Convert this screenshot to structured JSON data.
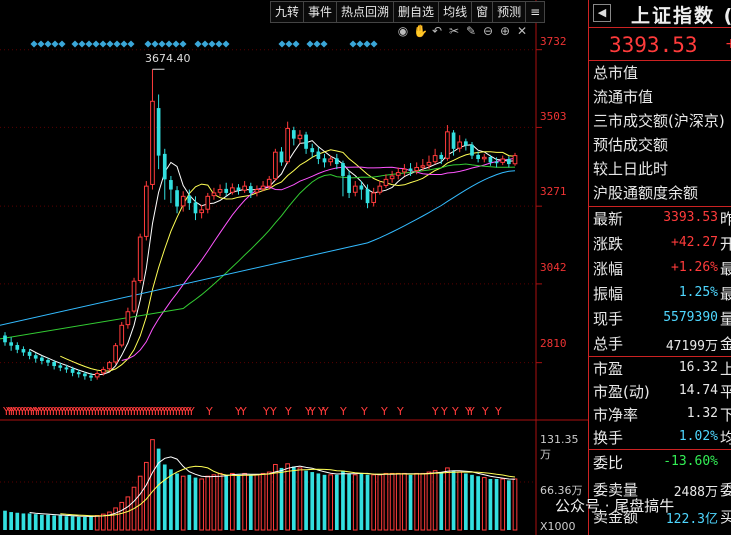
{
  "toolbar": {
    "buttons": [
      "九转",
      "事件",
      "热点回溯",
      "删自选",
      "均线",
      "窗",
      "预测",
      "≡"
    ]
  },
  "chart_icons": [
    "eye-icon",
    "hand-icon",
    "undo-icon",
    "scissors-icon",
    "pencil-icon",
    "zoom-out-icon",
    "zoom-in-icon",
    "close-icon"
  ],
  "chart_data": {
    "type": "candlestick",
    "price_axis_labels": [
      "3732",
      "3503",
      "3271",
      "3042",
      "2810"
    ],
    "price_range": [
      2700,
      3790
    ],
    "peak_label": "3674.40",
    "peak_value": 3674.4,
    "volume_axis_labels": [
      "131.35万",
      "66.36万",
      "X1000"
    ],
    "volume_range": [
      0,
      1450000
    ],
    "candles": [
      [
        2890,
        2870,
        2900,
        2860
      ],
      [
        2870,
        2860,
        2885,
        2845
      ],
      [
        2862,
        2848,
        2870,
        2838
      ],
      [
        2850,
        2840,
        2858,
        2830
      ],
      [
        2842,
        2830,
        2850,
        2820
      ],
      [
        2832,
        2822,
        2838,
        2810
      ],
      [
        2825,
        2815,
        2830,
        2805
      ],
      [
        2818,
        2810,
        2824,
        2800
      ],
      [
        2812,
        2800,
        2818,
        2790
      ],
      [
        2802,
        2795,
        2810,
        2785
      ],
      [
        2796,
        2790,
        2804,
        2780
      ],
      [
        2792,
        2780,
        2798,
        2770
      ],
      [
        2782,
        2776,
        2790,
        2766
      ],
      [
        2778,
        2770,
        2784,
        2760
      ],
      [
        2772,
        2766,
        2780,
        2756
      ],
      [
        2768,
        2778,
        2785,
        2760
      ],
      [
        2780,
        2790,
        2798,
        2772
      ],
      [
        2792,
        2810,
        2815,
        2785
      ],
      [
        2812,
        2860,
        2868,
        2805
      ],
      [
        2862,
        2920,
        2930,
        2855
      ],
      [
        2922,
        2960,
        2972,
        2910
      ],
      [
        2962,
        3050,
        3060,
        2955
      ],
      [
        3052,
        3180,
        3190,
        3045
      ],
      [
        3182,
        3330,
        3345,
        3170
      ],
      [
        3335,
        3580,
        3674,
        3320
      ],
      [
        3560,
        3420,
        3600,
        3380
      ],
      [
        3425,
        3350,
        3440,
        3290
      ],
      [
        3348,
        3320,
        3360,
        3280
      ],
      [
        3318,
        3270,
        3330,
        3250
      ],
      [
        3272,
        3300,
        3315,
        3255
      ],
      [
        3302,
        3280,
        3320,
        3260
      ],
      [
        3282,
        3250,
        3300,
        3230
      ],
      [
        3252,
        3260,
        3275,
        3235
      ],
      [
        3262,
        3300,
        3310,
        3250
      ],
      [
        3302,
        3310,
        3325,
        3290
      ],
      [
        3312,
        3320,
        3335,
        3300
      ],
      [
        3322,
        3310,
        3340,
        3300
      ],
      [
        3312,
        3325,
        3338,
        3305
      ],
      [
        3326,
        3318,
        3336,
        3305
      ],
      [
        3318,
        3330,
        3345,
        3310
      ],
      [
        3330,
        3310,
        3340,
        3295
      ],
      [
        3312,
        3320,
        3332,
        3300
      ],
      [
        3322,
        3330,
        3345,
        3315
      ],
      [
        3330,
        3350,
        3360,
        3320
      ],
      [
        3352,
        3430,
        3440,
        3345
      ],
      [
        3432,
        3400,
        3445,
        3390
      ],
      [
        3402,
        3500,
        3520,
        3395
      ],
      [
        3495,
        3470,
        3505,
        3450
      ],
      [
        3470,
        3480,
        3495,
        3455
      ],
      [
        3482,
        3440,
        3490,
        3425
      ],
      [
        3442,
        3430,
        3455,
        3415
      ],
      [
        3432,
        3410,
        3445,
        3395
      ],
      [
        3412,
        3400,
        3425,
        3385
      ],
      [
        3402,
        3410,
        3420,
        3390
      ],
      [
        3412,
        3395,
        3425,
        3380
      ],
      [
        3398,
        3360,
        3405,
        3300
      ],
      [
        3362,
        3310,
        3375,
        3295
      ],
      [
        3312,
        3330,
        3345,
        3300
      ],
      [
        3332,
        3320,
        3345,
        3290
      ],
      [
        3322,
        3280,
        3335,
        3265
      ],
      [
        3282,
        3310,
        3325,
        3270
      ],
      [
        3312,
        3330,
        3345,
        3305
      ],
      [
        3332,
        3350,
        3365,
        3325
      ],
      [
        3352,
        3360,
        3375,
        3340
      ],
      [
        3362,
        3370,
        3385,
        3350
      ],
      [
        3372,
        3380,
        3395,
        3360
      ],
      [
        3382,
        3375,
        3398,
        3360
      ],
      [
        3376,
        3385,
        3400,
        3365
      ],
      [
        3386,
        3390,
        3410,
        3375
      ],
      [
        3392,
        3400,
        3420,
        3380
      ],
      [
        3402,
        3420,
        3440,
        3395
      ],
      [
        3422,
        3410,
        3430,
        3395
      ],
      [
        3412,
        3490,
        3510,
        3405
      ],
      [
        3488,
        3440,
        3495,
        3420
      ],
      [
        3442,
        3460,
        3480,
        3430
      ],
      [
        3462,
        3450,
        3470,
        3435
      ],
      [
        3452,
        3420,
        3460,
        3410
      ],
      [
        3422,
        3410,
        3432,
        3400
      ],
      [
        3412,
        3415,
        3425,
        3400
      ],
      [
        3416,
        3400,
        3422,
        3390
      ],
      [
        3402,
        3398,
        3415,
        3385
      ],
      [
        3400,
        3410,
        3420,
        3392
      ],
      [
        3410,
        3395,
        3418,
        3385
      ],
      [
        3396,
        3420,
        3428,
        3390
      ]
    ],
    "volumes": [
      28,
      26,
      25,
      24,
      24,
      23,
      22,
      22,
      21,
      21,
      20,
      20,
      19,
      19,
      20,
      21,
      23,
      26,
      32,
      40,
      48,
      62,
      78,
      98,
      131,
      118,
      95,
      88,
      82,
      78,
      80,
      76,
      74,
      78,
      80,
      82,
      80,
      82,
      80,
      82,
      80,
      80,
      82,
      84,
      95,
      90,
      96,
      92,
      90,
      86,
      84,
      82,
      80,
      80,
      80,
      86,
      82,
      80,
      82,
      80,
      80,
      80,
      82,
      82,
      82,
      82,
      80,
      82,
      82,
      84,
      86,
      84,
      90,
      86,
      84,
      82,
      80,
      78,
      76,
      74,
      74,
      74,
      72,
      74
    ],
    "signal_marker": "Y"
  },
  "panel": {
    "back_icon": "◀",
    "title": "上证指数",
    "title_suffix": "(",
    "price": "3393.53",
    "price_suffix": "+",
    "info_rows": [
      "总市值",
      "流通市值",
      "三市成交额(沪深京)",
      "预估成交额",
      "较上日此时",
      "沪股通额度余额"
    ],
    "quotes": [
      {
        "label": "最新",
        "value": "3393.53",
        "tail": "昨",
        "color": "#ff3b3b"
      },
      {
        "label": "涨跌",
        "value": "+42.27",
        "tail": "开",
        "color": "#ff3b3b"
      },
      {
        "label": "涨幅",
        "value": "+1.26%",
        "tail": "最",
        "color": "#ff3b3b"
      },
      {
        "label": "振幅",
        "value": "1.25%",
        "tail": "最",
        "color": "#4fd7ff"
      },
      {
        "label": "现手",
        "value": "5579390",
        "tail": "量",
        "color": "#4fd7ff"
      },
      {
        "label": "总手",
        "value": "47199万",
        "tail": "金",
        "color": "#e8e8e8"
      }
    ],
    "ratios": [
      {
        "label": "市盈",
        "value": "16.32",
        "tail": "上",
        "color": "#e8e8e8"
      },
      {
        "label": "市盈(动)",
        "value": "14.74",
        "tail": "平",
        "color": "#e8e8e8"
      },
      {
        "label": "市净率",
        "value": "1.32",
        "tail": "下",
        "color": "#e8e8e8"
      },
      {
        "label": "换手",
        "value": "1.02%",
        "tail": "均",
        "color": "#4fd7ff"
      }
    ],
    "bids": [
      {
        "label": "委比",
        "value": "-13.60%",
        "tail": "",
        "color": "#33ee55"
      },
      {
        "label": "委卖量",
        "value": "2488万",
        "tail": "委",
        "color": "#e8e8e8"
      },
      {
        "label": "卖金额",
        "value": "122.3亿",
        "tail": "买",
        "color": "#4fd7ff"
      }
    ]
  },
  "watermark": "公众号 · 尾盘搞牛"
}
